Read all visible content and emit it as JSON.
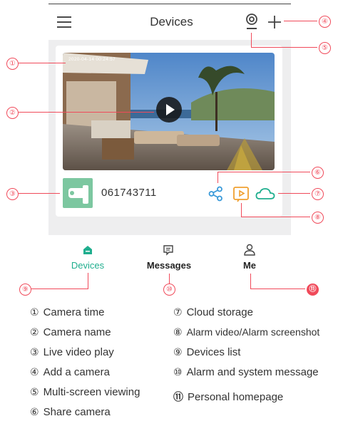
{
  "header": {
    "title": "Devices"
  },
  "camera": {
    "timestamp": "2020-04-14 00:24:57",
    "name": "061743711"
  },
  "nav": {
    "items": [
      {
        "label": "Devices"
      },
      {
        "label": "Messages"
      },
      {
        "label": "Me"
      }
    ]
  },
  "callouts": [
    "①",
    "②",
    "③",
    "④",
    "⑤",
    "⑥",
    "⑦",
    "⑧",
    "⑨",
    "⑩",
    "⑪"
  ],
  "legend": [
    {
      "num": "①",
      "text": "Camera time"
    },
    {
      "num": "②",
      "text": "Camera name"
    },
    {
      "num": "③",
      "text": "Live video play"
    },
    {
      "num": "④",
      "text": "Add a camera"
    },
    {
      "num": "⑤",
      "text": "Multi-screen viewing"
    },
    {
      "num": "⑥",
      "text": "Share camera"
    },
    {
      "num": "⑦",
      "text": "Cloud storage"
    },
    {
      "num": "⑧",
      "text": "Alarm video/Alarm screenshot"
    },
    {
      "num": "⑨",
      "text": "Devices list"
    },
    {
      "num": "⑩",
      "text": "Alarm and system message"
    },
    {
      "num": "⑪",
      "text": "Personal homepage"
    }
  ],
  "colors": {
    "accent": "#1fae8e",
    "annotation": "#f04a5a",
    "share": "#3a9ad9",
    "alarm": "#f0a030",
    "cloud": "#1fae8e"
  },
  "icons": [
    "menu-icon",
    "multi-screen-icon",
    "add-icon",
    "play-icon",
    "share-icon",
    "alarm-video-icon",
    "cloud-icon",
    "devices-nav-icon",
    "messages-nav-icon",
    "me-nav-icon"
  ]
}
